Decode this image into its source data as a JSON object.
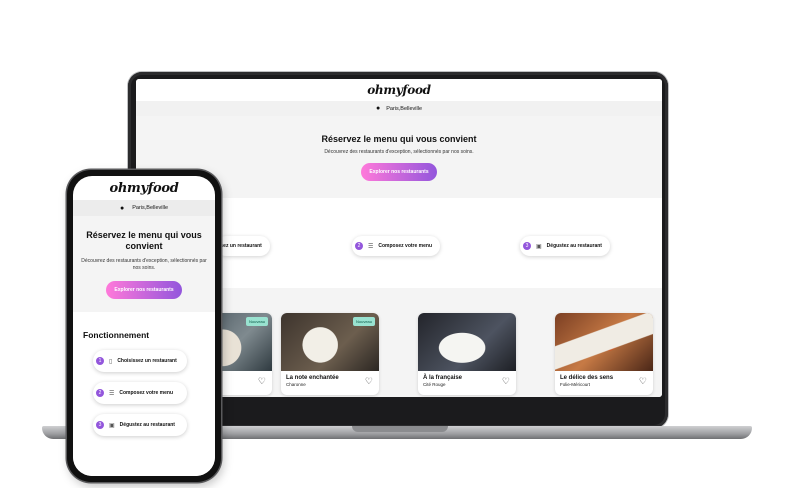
{
  "brand": {
    "logo": "ohmyfood",
    "accent_start": "#ff79da",
    "accent_end": "#9356dc"
  },
  "location": {
    "text": "Paris,Belleville",
    "icon": "map-pin-icon"
  },
  "hero": {
    "title": "Réservez le menu qui vous convient",
    "subtitle": "Découvrez des restaurants d'exception, sélectionnés par nos soins.",
    "cta_label": "Explorer nos restaurants"
  },
  "how_it_works": {
    "title": "Fonctionnement",
    "desktop_title_fragment": "t",
    "steps": [
      {
        "num": "1",
        "icon": "phone-icon",
        "label": "Choisissez un restaurant",
        "desktop_label": "isez un restaurant"
      },
      {
        "num": "2",
        "icon": "list-icon",
        "label": "Composez votre menu"
      },
      {
        "num": "3",
        "icon": "menu-card-icon",
        "label": "Dégustez au restaurant"
      }
    ]
  },
  "restaurants": [
    {
      "name": "",
      "location": "",
      "badge": "Nouveau"
    },
    {
      "name": "La note enchantée",
      "location": "Charonne",
      "badge": "Nouveau"
    },
    {
      "name": "À la française",
      "location": "Cité Rouge",
      "badge": ""
    },
    {
      "name": "Le délice des sens",
      "location": "Folie-Méricourt",
      "badge": ""
    }
  ]
}
